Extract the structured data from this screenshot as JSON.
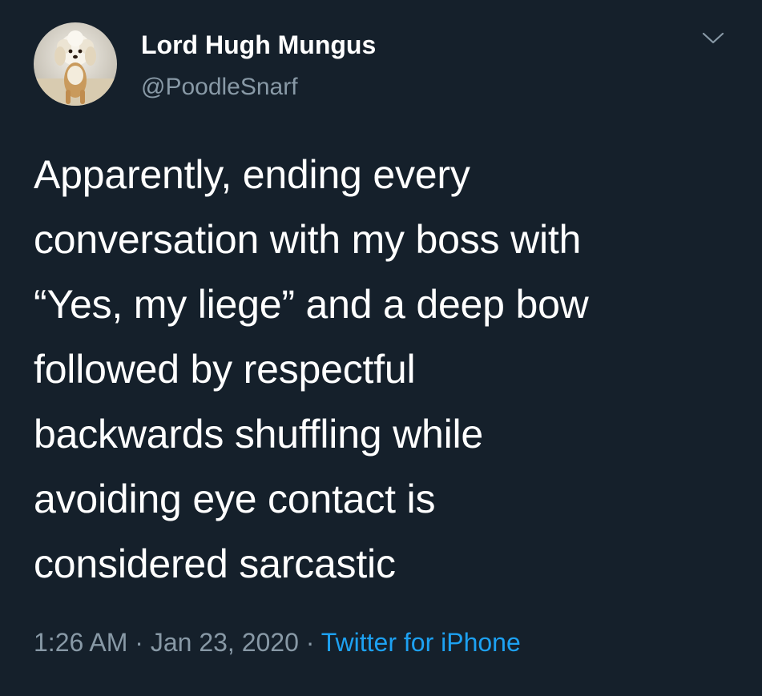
{
  "author": {
    "display_name": "Lord Hugh Mungus",
    "handle": "@PoodleSnarf"
  },
  "tweet": {
    "text": "Apparently, ending every\nconversation with my boss with\n“Yes, my liege” and a deep bow\nfollowed by respectful\nbackwards shuffling while\navoiding eye contact is\nconsidered sarcastic"
  },
  "meta": {
    "time": "1:26 AM",
    "separator": "·",
    "date": "Jan 23, 2020",
    "source": "Twitter for iPhone"
  },
  "icons": {
    "avatar": "poodle-avatar",
    "menu": "chevron-down-icon"
  },
  "colors": {
    "background": "#15202b",
    "text": "#ffffff",
    "muted": "#8899a6",
    "link": "#1da1f2"
  }
}
